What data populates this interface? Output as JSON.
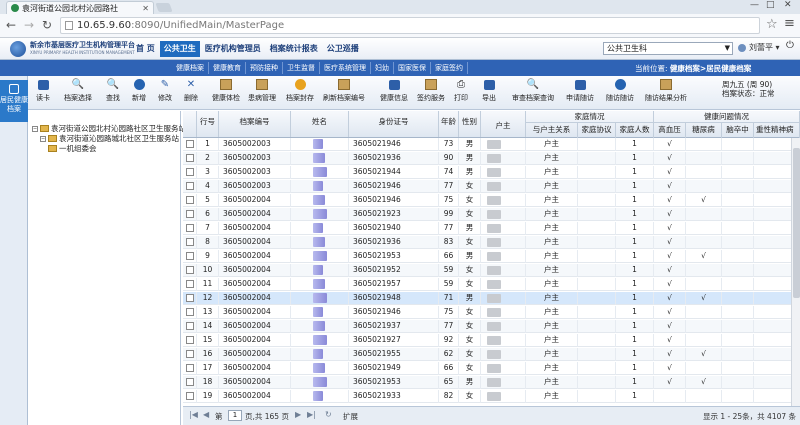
{
  "browser": {
    "tab_title": "袁河街道公园北村沁园路社",
    "url_domain": "10.65.9.60",
    "url_path": ":8090/UnifiedMain/MasterPage"
  },
  "app": {
    "logo_title": "新余市基层医疗卫生机构管理平台",
    "logo_subtitle": "XINYU PRIMARY HEALTH INSTITUTION MANAGEMENT",
    "top_menu": [
      "首 页",
      "公共卫生",
      "医疗机构管理员",
      "档案统计报表",
      "公卫巡播"
    ],
    "active_top_menu": "公共卫生",
    "system_select": "公共卫生科",
    "user": "刘蕾平"
  },
  "subnav": {
    "items": [
      "健康档案",
      "健康教育",
      "预防接种",
      "卫生监督",
      "医疗系统管理",
      "妇幼",
      "国家医保",
      "家庭签约"
    ],
    "location_label": "当前位置:",
    "location_value": "健康档案>居民健康档案"
  },
  "left_tab": {
    "label": "居民健康档案"
  },
  "toolbar": {
    "items": [
      {
        "label": "读卡",
        "icon": "card-reader-icon"
      },
      {
        "label": "档案选择",
        "icon": "search-icon"
      },
      {
        "label": "查找",
        "icon": "search-icon"
      },
      {
        "label": "新增",
        "icon": "add-icon"
      },
      {
        "label": "修改",
        "icon": "edit-icon"
      },
      {
        "label": "删除",
        "icon": "delete-icon"
      },
      {
        "label": "健康体检",
        "icon": "checkup-icon"
      },
      {
        "label": "患病管理",
        "icon": "disease-icon"
      },
      {
        "label": "档案封存",
        "icon": "archive-icon"
      },
      {
        "label": "刷新档案编号",
        "icon": "refresh-icon"
      },
      {
        "label": "健康信息",
        "icon": "health-info-icon"
      },
      {
        "label": "签约服务",
        "icon": "contract-icon"
      },
      {
        "label": "打印",
        "icon": "print-icon"
      },
      {
        "label": "导出",
        "icon": "export-icon"
      },
      {
        "label": "审查档案查询",
        "icon": "search-icon"
      },
      {
        "label": "申请随访",
        "icon": "followup-icon"
      },
      {
        "label": "随访随访",
        "icon": "followup2-icon"
      },
      {
        "label": "随访结果分析",
        "icon": "analysis-icon"
      }
    ],
    "week_label": "周九五 (周 90)",
    "status_label": "档案状态：正常"
  },
  "tree": {
    "root": "袁河街道公园北村沁园路社区卫生服务站",
    "child": "袁河街道沁园路城北社区卫生服务站",
    "leaf": "一机组委会"
  },
  "grid": {
    "headers": {
      "seq": "行号",
      "file_no": "档案编号",
      "name": "姓名",
      "id_no": "身份证号",
      "age": "年龄",
      "sex": "性别",
      "householder": "户主",
      "family_group": "家庭情况",
      "relation": "与户主关系",
      "family_agreement": "家庭协议",
      "family_count": "家庭人数",
      "health_group": "健康问题情况",
      "hypertension": "高血压",
      "diabetes": "糖尿病",
      "stroke": "脑卒中",
      "mental": "重性精神病"
    },
    "rows": [
      {
        "seq": "1",
        "file_no": "3605002003",
        "id_no": "3605021946",
        "age": "73",
        "sex": "男",
        "relation": "户主",
        "family_count": "1",
        "htn": "√",
        "dm": ""
      },
      {
        "seq": "2",
        "file_no": "3605002003",
        "id_no": "3605021936",
        "age": "90",
        "sex": "男",
        "relation": "户主",
        "family_count": "1",
        "htn": "√",
        "dm": ""
      },
      {
        "seq": "3",
        "file_no": "3605002003",
        "id_no": "3605021944",
        "age": "74",
        "sex": "男",
        "relation": "户主",
        "family_count": "1",
        "htn": "√",
        "dm": ""
      },
      {
        "seq": "4",
        "file_no": "3605002003",
        "id_no": "3605021946",
        "age": "77",
        "sex": "女",
        "relation": "户主",
        "family_count": "1",
        "htn": "√",
        "dm": ""
      },
      {
        "seq": "5",
        "file_no": "3605002004",
        "id_no": "3605021946",
        "age": "75",
        "sex": "女",
        "relation": "户主",
        "family_count": "1",
        "htn": "√",
        "dm": "√"
      },
      {
        "seq": "6",
        "file_no": "3605002004",
        "id_no": "3605021923",
        "age": "99",
        "sex": "女",
        "relation": "户主",
        "family_count": "1",
        "htn": "√",
        "dm": ""
      },
      {
        "seq": "7",
        "file_no": "3605002004",
        "id_no": "3605021940",
        "age": "77",
        "sex": "男",
        "relation": "户主",
        "family_count": "1",
        "htn": "√",
        "dm": ""
      },
      {
        "seq": "8",
        "file_no": "3605002004",
        "id_no": "3605021936",
        "age": "83",
        "sex": "女",
        "relation": "户主",
        "family_count": "1",
        "htn": "√",
        "dm": ""
      },
      {
        "seq": "9",
        "file_no": "3605002004",
        "id_no": "3605021953",
        "age": "66",
        "sex": "男",
        "relation": "户主",
        "family_count": "1",
        "htn": "√",
        "dm": "√"
      },
      {
        "seq": "10",
        "file_no": "3605002004",
        "id_no": "3605021952",
        "age": "59",
        "sex": "女",
        "relation": "户主",
        "family_count": "1",
        "htn": "√",
        "dm": ""
      },
      {
        "seq": "11",
        "file_no": "3605002004",
        "id_no": "3605021957",
        "age": "59",
        "sex": "女",
        "relation": "户主",
        "family_count": "1",
        "htn": "√",
        "dm": ""
      },
      {
        "seq": "12",
        "file_no": "3605002004",
        "id_no": "3605021948",
        "age": "71",
        "sex": "男",
        "relation": "户主",
        "family_count": "1",
        "htn": "√",
        "dm": "√"
      },
      {
        "seq": "13",
        "file_no": "3605002004",
        "id_no": "3605021946",
        "age": "75",
        "sex": "女",
        "relation": "户主",
        "family_count": "1",
        "htn": "√",
        "dm": ""
      },
      {
        "seq": "14",
        "file_no": "3605002004",
        "id_no": "3605021937",
        "age": "77",
        "sex": "女",
        "relation": "户主",
        "family_count": "1",
        "htn": "√",
        "dm": ""
      },
      {
        "seq": "15",
        "file_no": "3605002004",
        "id_no": "3605021927",
        "age": "92",
        "sex": "女",
        "relation": "户主",
        "family_count": "1",
        "htn": "√",
        "dm": ""
      },
      {
        "seq": "16",
        "file_no": "3605002004",
        "id_no": "3605021955",
        "age": "62",
        "sex": "女",
        "relation": "户主",
        "family_count": "1",
        "htn": "√",
        "dm": "√"
      },
      {
        "seq": "17",
        "file_no": "3605002004",
        "id_no": "3605021949",
        "age": "66",
        "sex": "女",
        "relation": "户主",
        "family_count": "1",
        "htn": "√",
        "dm": ""
      },
      {
        "seq": "18",
        "file_no": "3605002004",
        "id_no": "3605021953",
        "age": "65",
        "sex": "男",
        "relation": "户主",
        "family_count": "1",
        "htn": "√",
        "dm": "√"
      },
      {
        "seq": "19",
        "file_no": "3605002004",
        "id_no": "3605021933",
        "age": "82",
        "sex": "女",
        "relation": "户主",
        "family_count": "1",
        "htn": "",
        "dm": ""
      }
    ],
    "selected_row": 12
  },
  "pager": {
    "page_prefix": "第",
    "page_value": "1",
    "page_suffix": "页,共 165 页",
    "expand": "扩展",
    "summary": "显示 1 - 25条，共 4107 条"
  }
}
